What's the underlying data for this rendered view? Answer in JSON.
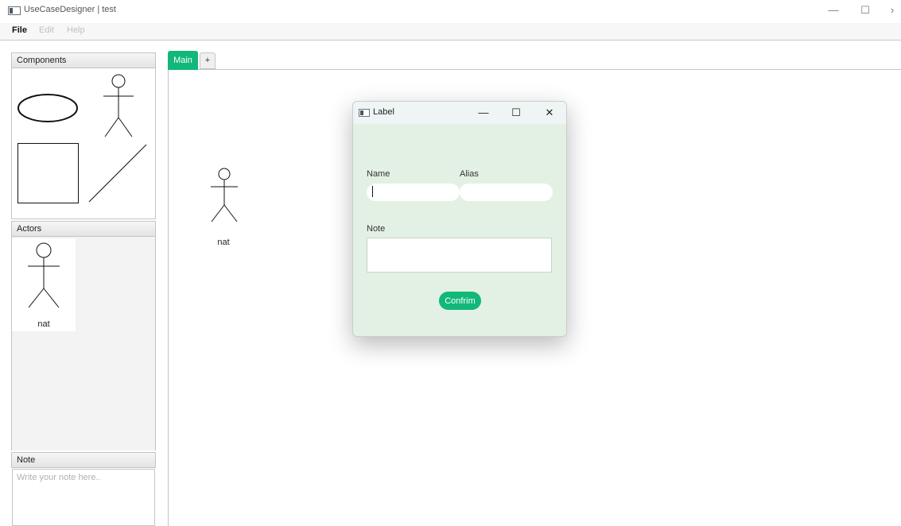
{
  "window": {
    "title": "UseCaseDesigner | test",
    "controls": {
      "minimize": "—",
      "maximize": "☐",
      "close": "›"
    }
  },
  "menu": {
    "items": [
      {
        "label": "File",
        "enabled": true
      },
      {
        "label": "Edit",
        "enabled": false
      },
      {
        "label": "Help",
        "enabled": false
      }
    ]
  },
  "sidebar": {
    "components_header": "Components",
    "components": [
      {
        "icon": "use-case-ellipse-icon"
      },
      {
        "icon": "actor-stick-figure-icon"
      },
      {
        "icon": "system-boundary-rectangle-icon"
      },
      {
        "icon": "association-line-icon"
      }
    ],
    "actors_header": "Actors",
    "actors": [
      {
        "label": "nat",
        "icon": "actor-stick-figure-icon"
      }
    ],
    "note_header": "Note",
    "note_placeholder": "Write your note here.."
  },
  "tabs": {
    "items": [
      {
        "label": "Main",
        "active": true
      }
    ],
    "add_label": "+"
  },
  "canvas": {
    "actors": [
      {
        "label": "nat",
        "icon": "actor-stick-figure-icon"
      }
    ]
  },
  "dialog": {
    "title": "Label",
    "controls": {
      "minimize": "—",
      "maximize": "☐",
      "close": "✕"
    },
    "name_label": "Name",
    "name_value": "",
    "alias_label": "Alias",
    "alias_value": "",
    "note_label": "Note",
    "note_value": "",
    "confirm_label": "Confrim"
  },
  "colors": {
    "accent": "#12b77a",
    "dialog_background": "#e2f1e3",
    "panel_header": "#e4e4e4"
  }
}
